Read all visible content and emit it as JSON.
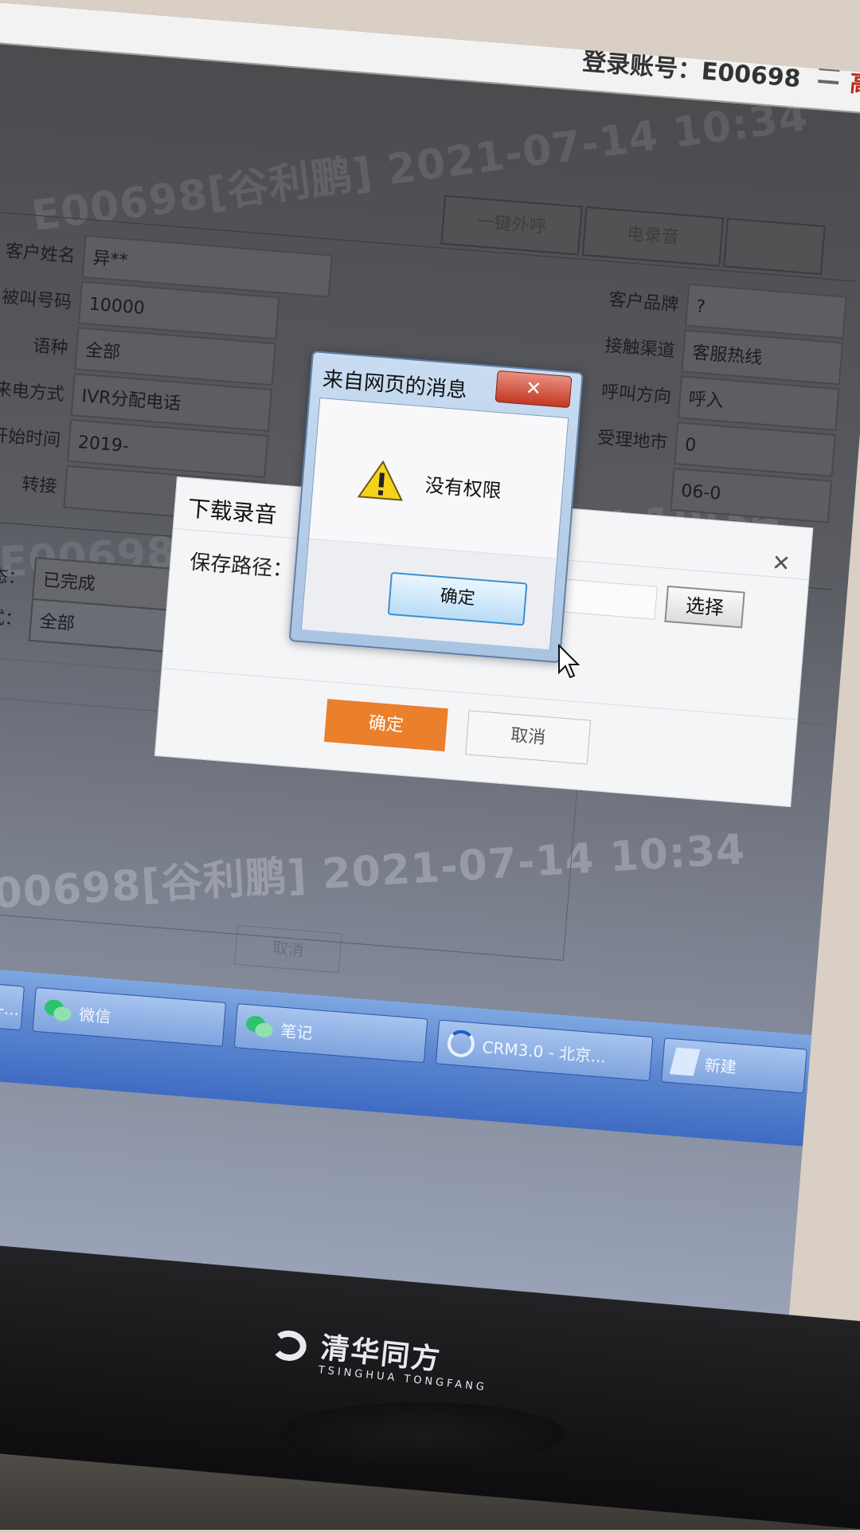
{
  "topbar": {
    "login_info": "登录账号：E00698",
    "right_text": "高"
  },
  "tabs": [
    {
      "label": "一键外呼"
    },
    {
      "label": "电录音"
    }
  ],
  "form": {
    "customer_name_label": "客户姓名",
    "customer_name_value": "异**",
    "called_number_label": "被叫号码",
    "called_number_value": "10000",
    "language_label": "语种",
    "language_value": "全部",
    "call_method_label": "来电方式",
    "call_method_value": "IVR分配电话",
    "start_time_label": "开始时间",
    "start_time_value": "2019-",
    "transfer_label": "转接",
    "customer_brand_label": "客户品牌",
    "customer_brand_value": "?",
    "contact_channel_label": "接触渠道",
    "contact_channel_value": "客服热线",
    "call_direction_label": "呼叫方向",
    "call_direction_value": "呼入",
    "city_label": "受理地市",
    "city_value": "0",
    "right_partial_value": "06-0",
    "request_status_label": "请求状态：",
    "request_status_value": "已完成",
    "reply_method_label": "答复方式：",
    "reply_method_value": "全部"
  },
  "watermark_text": "E00698[谷利鹏] 2021-07-14 10:34",
  "bottom_cancel": "取消",
  "taskbar": [
    {
      "label": "智慧服务平台 -...",
      "icon": "ie-icon"
    },
    {
      "label": "微信",
      "icon": "wechat-icon"
    },
    {
      "label": "笔记",
      "icon": "wechat-icon"
    },
    {
      "label": "CRM3.0 - 北京...",
      "icon": "crm-icon"
    },
    {
      "label": "新建",
      "icon": "doc-icon"
    }
  ],
  "download_dialog": {
    "title": "下载录音",
    "path_label": "保存路径：",
    "select_button": "选择",
    "ok_button": "确定",
    "cancel_button": "取消"
  },
  "alert": {
    "title": "来自网页的消息",
    "close_glyph": "✕",
    "message": "没有权限",
    "ok_button": "确定"
  },
  "monitor": {
    "brand_cn": "清华同方",
    "brand_en": "TSINGHUA TONGFANG"
  }
}
